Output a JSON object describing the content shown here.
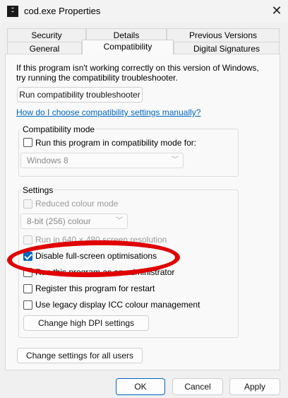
{
  "window": {
    "title": "cod.exe Properties",
    "icon": "app-icon"
  },
  "tabs_row1": [
    {
      "label": "Security"
    },
    {
      "label": "Details"
    },
    {
      "label": "Previous Versions"
    }
  ],
  "tabs_row2": [
    {
      "label": "General"
    },
    {
      "label": "Compatibility",
      "active": true
    },
    {
      "label": "Digital Signatures"
    }
  ],
  "intro": {
    "line1": "If this program isn't working correctly on this version of Windows,",
    "line2": "try running the compatibility troubleshooter."
  },
  "troubleshooter_button": "Run compatibility troubleshooter",
  "manual_link": "How do I choose compatibility settings manually?",
  "compat_mode": {
    "label": "Compatibility mode",
    "checkbox_label": "Run this program in compatibility mode for:",
    "checked": false,
    "select_value": "Windows 8"
  },
  "settings": {
    "label": "Settings",
    "reduced_colour": {
      "label": "Reduced colour mode",
      "checked": false,
      "disabled": true
    },
    "colour_select": "8-bit (256) colour",
    "resolution": {
      "label": "Run in 640 × 480 screen resolution",
      "checked": false,
      "disabled": true
    },
    "fullscreen": {
      "label": "Disable full-screen optimisations",
      "checked": true
    },
    "admin": {
      "label": "Run this program as an administrator",
      "checked": false
    },
    "restart": {
      "label": "Register this program for restart",
      "checked": false
    },
    "icc": {
      "label": "Use legacy display ICC colour management",
      "checked": false
    },
    "dpi_button": "Change high DPI settings"
  },
  "all_users_button": "Change settings for all users",
  "footer": {
    "ok": "OK",
    "cancel": "Cancel",
    "apply": "Apply"
  },
  "annotation_color": "#e00000",
  "accent_color": "#0067c0"
}
